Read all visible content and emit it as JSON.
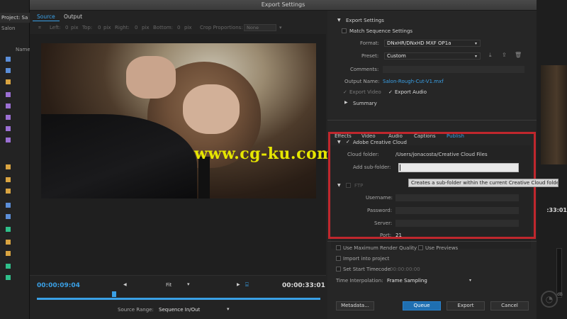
{
  "background": {
    "project_label": "Project: Sa",
    "bin_label": "Salon",
    "name_col": "Name",
    "right_timecode": ":33:01",
    "meter_label": "dB",
    "swatches": [
      "#5b8ed8",
      "#5b8ed8",
      "#d9a441",
      "#9b6fd3",
      "#9b6fd3",
      "#9b6fd3",
      "#9b6fd3",
      "#9b6fd3",
      "#d9a441",
      "#d9a441",
      "#d9a441",
      "#5b8ed8",
      "#5b8ed8",
      "#2fbf8a",
      "#d9a441",
      "#d9a441",
      "#2fbf8a",
      "#2fbf8a"
    ]
  },
  "dialog": {
    "title": "Export Settings",
    "tabs": {
      "source": "Source",
      "output": "Output"
    },
    "crop": {
      "left_label": "Left:",
      "left_val": "0",
      "left_unit": "pix",
      "top_label": "Top:",
      "top_val": "0",
      "top_unit": "pix",
      "right_label": "Right:",
      "right_val": "0",
      "right_unit": "pix",
      "bottom_label": "Bottom:",
      "bottom_val": "0",
      "bottom_unit": "pix",
      "proportions_label": "Crop Proportions:",
      "proportions_val": "None"
    },
    "watermark": "www.cg-ku.com",
    "timeline": {
      "in_tc": "00:00:09:04",
      "out_tc": "00:00:33:01",
      "fit": "Fit",
      "source_range_label": "Source Range:",
      "source_range_val": "Sequence In/Out"
    },
    "export_settings": {
      "header": "Export Settings",
      "match_sequence": "Match Sequence Settings",
      "format_label": "Format:",
      "format_val": "DNxHR/DNxHD MXF OP1a",
      "preset_label": "Preset:",
      "preset_val": "Custom",
      "comments_label": "Comments:",
      "output_name_label": "Output Name:",
      "output_name_val": "Salon-Rough-Cut-V1.mxf",
      "export_video": "Export Video",
      "export_audio": "Export Audio",
      "summary": "Summary"
    },
    "panel_tabs": [
      "Effects",
      "Video",
      "Audio",
      "Captions",
      "Publish"
    ],
    "publish": {
      "cc_header": "Adobe Creative Cloud",
      "cloud_folder_label": "Cloud folder:",
      "cloud_folder_val": "/Users/jonacosta/Creative Cloud Files",
      "subfolder_label": "Add sub-folder:",
      "tooltip": "Creates a sub-folder within the current Creative Cloud folder",
      "ftp_header": "FTP",
      "username_label": "Username:",
      "password_label": "Password:",
      "server_label": "Server:",
      "port_label": "Port:",
      "port_val": "21"
    },
    "options": {
      "max_render": "Use Maximum Render Quality",
      "use_previews": "Use Previews",
      "import_project": "Import into project",
      "set_start_tc": "Set Start Timecode",
      "start_tc_val": "00:00:00:00",
      "interp_label": "Time Interpolation:",
      "interp_val": "Frame Sampling"
    },
    "buttons": {
      "metadata": "Metadata...",
      "queue": "Queue",
      "export": "Export",
      "cancel": "Cancel"
    }
  }
}
